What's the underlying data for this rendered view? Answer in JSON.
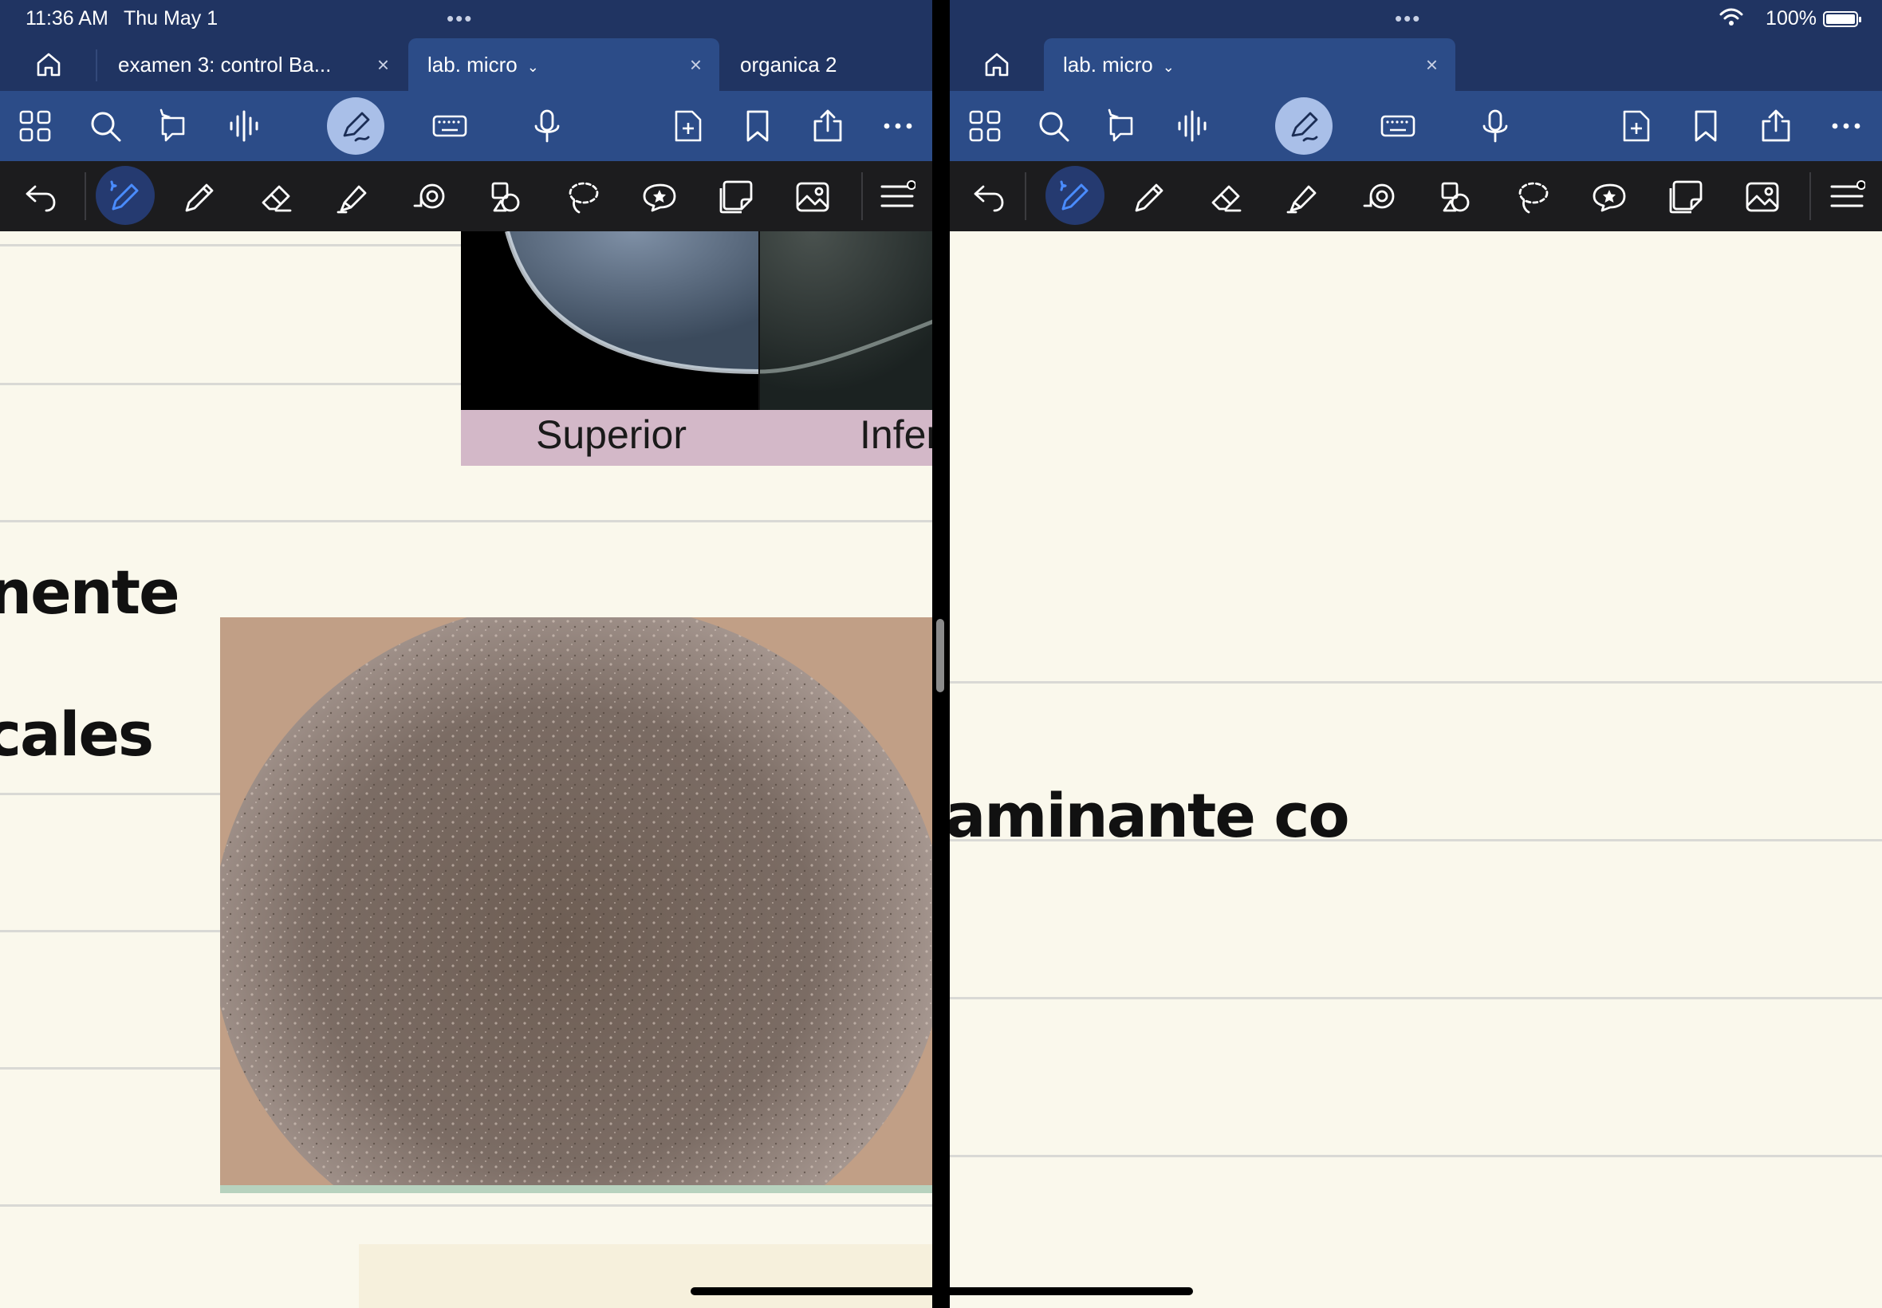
{
  "status": {
    "time": "11:36 AM",
    "date": "Thu May 1",
    "battery": "100%",
    "dots": "•••"
  },
  "left": {
    "tabs": [
      {
        "label": "examen 3: control Ba...",
        "close": "×"
      },
      {
        "label": "lab. micro",
        "close": "×",
        "chevron": "⌄"
      },
      {
        "label": "organica 2"
      }
    ],
    "captions": [
      "Superior",
      "Infer"
    ],
    "handwriting": [
      "nente",
      "cales"
    ]
  },
  "right": {
    "tabs": [
      {
        "label": "lab. micro",
        "close": "×",
        "chevron": "⌄"
      }
    ],
    "handwriting": [
      "aminante co"
    ]
  },
  "colors": {
    "header": "#203462",
    "toolbar": "#2c4c88",
    "penbar": "#1c1c1e",
    "paper": "#faf8ec",
    "rule": "#d9d9d5"
  }
}
